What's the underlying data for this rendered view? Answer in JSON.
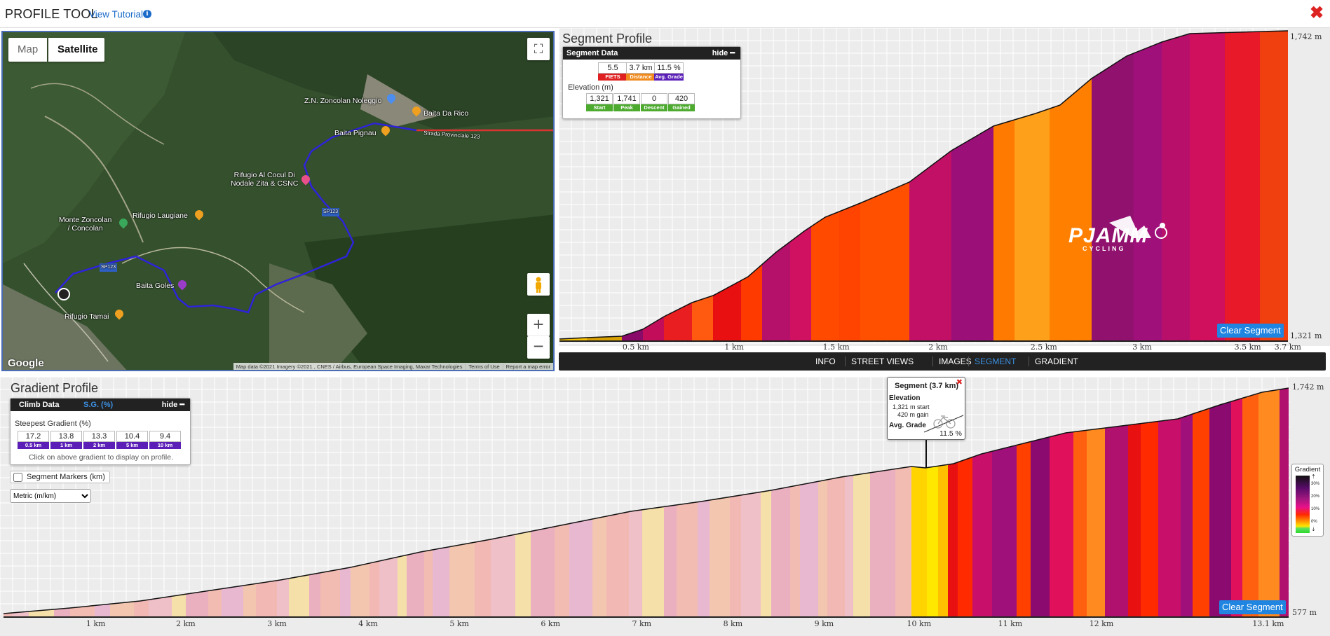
{
  "app": {
    "title": "PROFILE TOOL",
    "tutorial_link": "View Tutorial",
    "info_icon": "i",
    "close_icon": "✖"
  },
  "map": {
    "type_options": [
      "Map",
      "Satellite"
    ],
    "selected_type": "Satellite",
    "fullscreen_icon": "⛶",
    "zoom_in": "+",
    "zoom_out": "−",
    "logo": "Google",
    "attribution": [
      "Map data ©2021 Imagery ©2021 , CNES / Airbus, European Space Imaging, Maxar Technologies",
      "Terms of Use",
      "Report a map error"
    ],
    "places": {
      "noleggio": "Z.N. Zoncolan Noleggio",
      "da_rico": "Baita Da Rico",
      "pignau": "Baita Pignau",
      "road": "Strada Provinciale 123",
      "cocul_1": "Rifugio Al Cocul Di",
      "cocul_2": "Nodale Zita & CSNC",
      "monte_1": "Monte Zoncolan",
      "monte_2": "/ Concolan",
      "laugiane": "Rifugio Laugiane",
      "goles": "Baita Goles",
      "tamai": "Rifugio Tamai",
      "sp123_a": "SP123",
      "sp123_b": "SP123"
    }
  },
  "segment_profile": {
    "heading": "Segment Profile",
    "box_title": "Segment Data",
    "hide_label": "hide",
    "stats": [
      {
        "value": "5.5",
        "label": "FIETS",
        "color": "#e02020"
      },
      {
        "value": "3.7 km",
        "label": "Distance",
        "color": "#f08a1c"
      },
      {
        "value": "11.5 %",
        "label": "Avg. Grade",
        "color": "#5b1fb8"
      }
    ],
    "elevation_label": "Elevation (m)",
    "elevation": [
      {
        "value": "1,321",
        "label": "Start"
      },
      {
        "value": "1,741",
        "label": "Peak"
      },
      {
        "value": "0",
        "label": "Descent"
      },
      {
        "value": "420",
        "label": "Gained"
      }
    ],
    "elevation_color": "#4caa2e",
    "top_label": "1,742 m",
    "bottom_label": "1,321 m",
    "clear_button": "Clear Segment",
    "logo_main": "PJAMM",
    "logo_sub": "CYCLING",
    "ticks": [
      "0.5 km",
      "1 km",
      "1.5 km",
      "2 km",
      "2.5 km",
      "3 km",
      "3.5 km",
      "3.7 km"
    ]
  },
  "tabs": [
    {
      "label": "INFO",
      "active": false
    },
    {
      "label": "STREET VIEWS",
      "active": false
    },
    {
      "label": "IMAGES",
      "active": false
    },
    {
      "label": "SEGMENT",
      "active": true
    },
    {
      "label": "GRADIENT",
      "active": false
    }
  ],
  "gradient_profile": {
    "heading": "Gradient Profile",
    "climb_tab": "Climb Data",
    "sg_tab": "S.G. (%)",
    "hide_label": "hide",
    "steepest_label": "Steepest Gradient (%)",
    "steepest": [
      {
        "value": "17.2",
        "label": "0.5 km"
      },
      {
        "value": "13.8",
        "label": "1 km"
      },
      {
        "value": "13.3",
        "label": "2 km"
      },
      {
        "value": "10.4",
        "label": "5 km"
      },
      {
        "value": "9.4",
        "label": "10 km"
      }
    ],
    "hint": "Click on above gradient to display on profile.",
    "segment_markers": "Segment Markers (km)",
    "segment_markers_checked": false,
    "units_selected": "Metric (m/km)",
    "top_label": "1,742 m",
    "bottom_label": "577 m",
    "clear_button": "Clear Segment",
    "ticks": [
      "1 km",
      "2 km",
      "3 km",
      "4 km",
      "5 km",
      "6 km",
      "7 km",
      "8 km",
      "9 km",
      "10 km",
      "11 km",
      "12 km",
      "13.1 km"
    ],
    "tooltip": {
      "title": "Segment (3.7 km)",
      "elevation_label": "Elevation",
      "start": "1,321 m start",
      "gain": "420 m gain",
      "grade_label": "Avg. Grade",
      "grade": "11.5 %",
      "close_icon": "✖"
    },
    "legend": {
      "title": "Gradient",
      "labels": [
        "30%",
        "20%",
        "10%",
        "0%"
      ],
      "up_arrow": "⇡",
      "down_arrow": "⇣"
    }
  }
}
